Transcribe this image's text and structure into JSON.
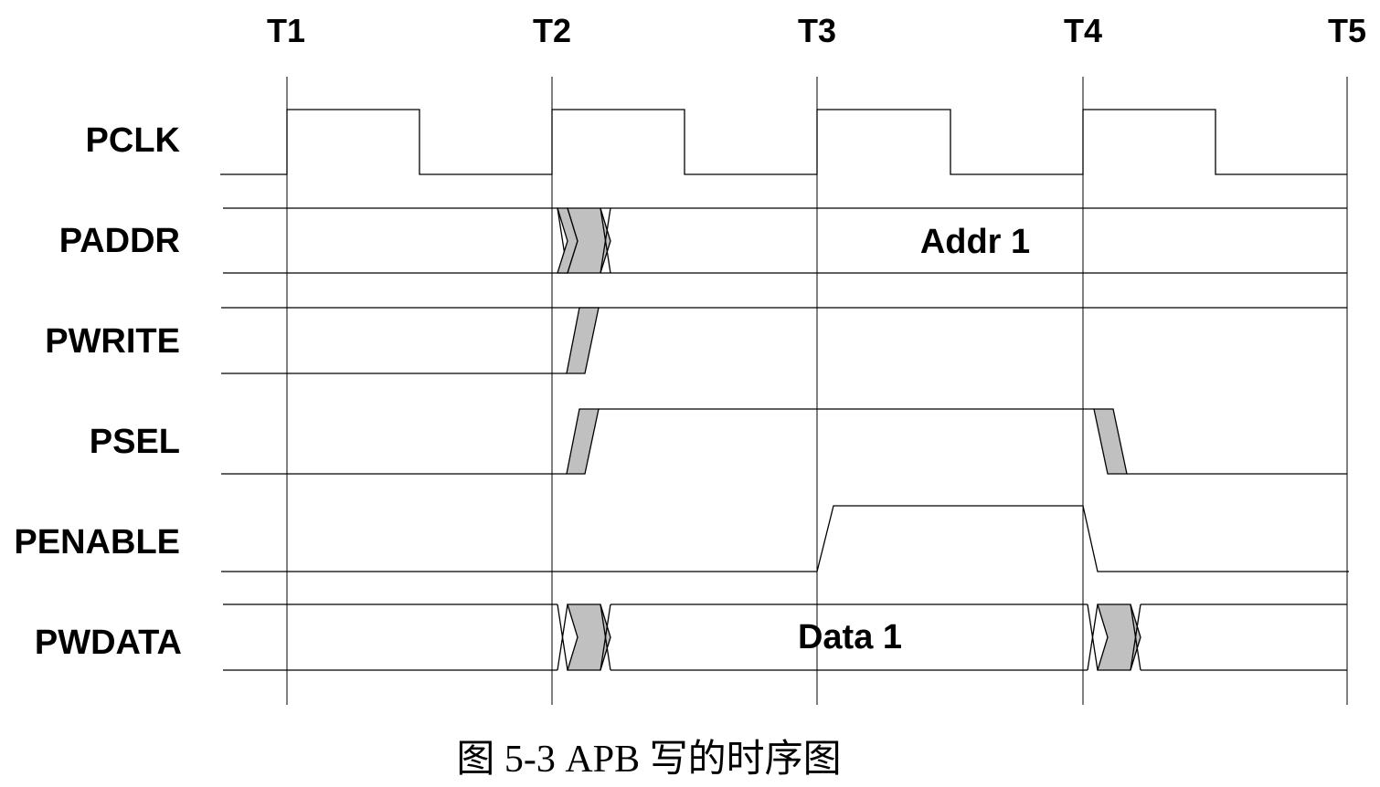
{
  "time_markers": [
    "T1",
    "T2",
    "T3",
    "T4",
    "T5"
  ],
  "signals": [
    {
      "id": "pclk",
      "label": "PCLK"
    },
    {
      "id": "paddr",
      "label": "PADDR",
      "bus_value": "Addr 1"
    },
    {
      "id": "pwrite",
      "label": "PWRITE"
    },
    {
      "id": "psel",
      "label": "PSEL"
    },
    {
      "id": "penable",
      "label": "PENABLE"
    },
    {
      "id": "pwdata",
      "label": "PWDATA",
      "bus_value": "Data 1"
    }
  ],
  "caption": "图 5-3 APB 写的时序图",
  "colors": {
    "transition_fill": "#c0c0c0",
    "line": "#000000",
    "background": "#ffffff"
  }
}
